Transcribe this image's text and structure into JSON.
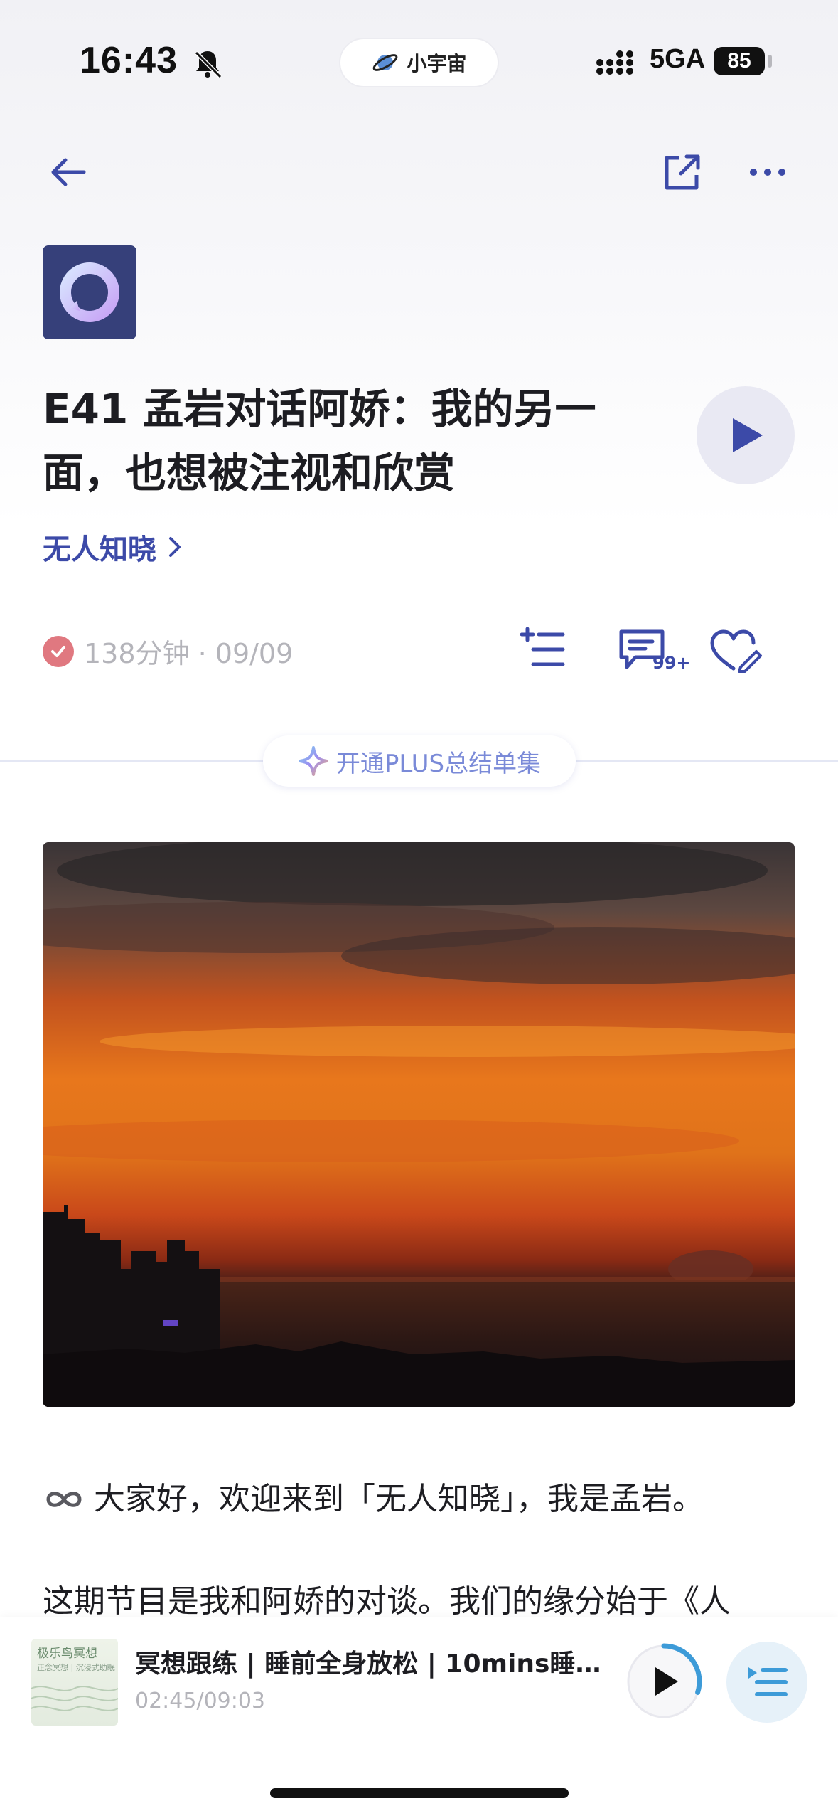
{
  "status_bar": {
    "time": "16:43",
    "center_app": "小宇宙",
    "network": "5GA",
    "battery": "85"
  },
  "podcast": {
    "name": "无人知晓"
  },
  "episode": {
    "title": "E41 孟岩对话阿娇：我的另一面，也想被注视和欣赏",
    "meta": "138分钟 · 09/09",
    "comment_count": "99+"
  },
  "plus_banner": {
    "label": "开通PLUS总结单集"
  },
  "shownotes": {
    "paragraph1": "大家好，欢迎来到「无人知晓」，我是孟岩。",
    "paragraph2": "这期节目是我和阿娇的对谈。我们的缘分始于《人"
  },
  "mini_player": {
    "cover_title": "极乐鸟冥想",
    "cover_subtitle": "正念冥想 | 沉浸式助眠",
    "title": "冥想跟练 | 睡前全身放松 | 10mins睡...",
    "time": "02:45/09:03",
    "progress": 0.3
  },
  "colors": {
    "accent": "#3c4aa8",
    "check": "#e07880",
    "muted": "#b4b4ba"
  }
}
